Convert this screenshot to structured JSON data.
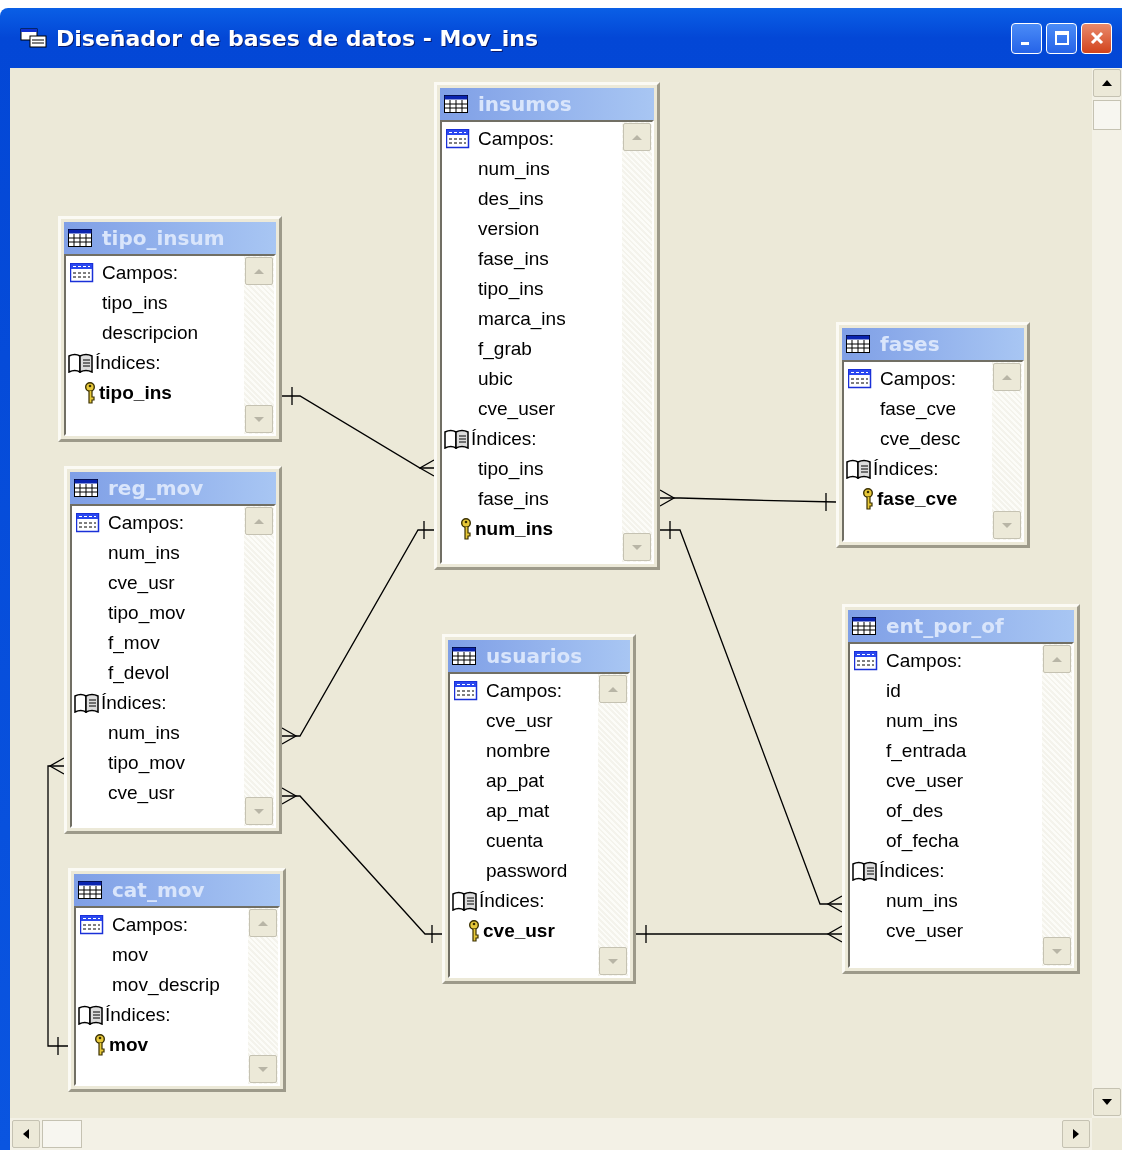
{
  "window": {
    "title": "Diseñador de bases de datos - Mov_ins"
  },
  "tables": [
    {
      "name": "tipo_insum",
      "items": [
        {
          "kind": "fields",
          "text": "Campos:"
        },
        {
          "kind": "field",
          "text": "tipo_ins"
        },
        {
          "kind": "field",
          "text": "descripcion"
        },
        {
          "kind": "indexes",
          "text": "Índices:"
        },
        {
          "kind": "key",
          "text": "tipo_ins"
        }
      ]
    },
    {
      "name": "reg_mov",
      "items": [
        {
          "kind": "fields",
          "text": "Campos:"
        },
        {
          "kind": "field",
          "text": "num_ins"
        },
        {
          "kind": "field",
          "text": "cve_usr"
        },
        {
          "kind": "field",
          "text": "tipo_mov"
        },
        {
          "kind": "field",
          "text": "f_mov"
        },
        {
          "kind": "field",
          "text": "f_devol"
        },
        {
          "kind": "indexes",
          "text": "Índices:"
        },
        {
          "kind": "field",
          "text": "num_ins"
        },
        {
          "kind": "field",
          "text": "tipo_mov"
        },
        {
          "kind": "field",
          "text": "cve_usr"
        }
      ]
    },
    {
      "name": "cat_mov",
      "items": [
        {
          "kind": "fields",
          "text": "Campos:"
        },
        {
          "kind": "field",
          "text": "mov"
        },
        {
          "kind": "field",
          "text": "mov_descrip"
        },
        {
          "kind": "indexes",
          "text": "Índices:"
        },
        {
          "kind": "key",
          "text": "mov"
        }
      ]
    },
    {
      "name": "insumos",
      "items": [
        {
          "kind": "fields",
          "text": "Campos:"
        },
        {
          "kind": "field",
          "text": "num_ins"
        },
        {
          "kind": "field",
          "text": "des_ins"
        },
        {
          "kind": "field",
          "text": "version"
        },
        {
          "kind": "field",
          "text": "fase_ins"
        },
        {
          "kind": "field",
          "text": "tipo_ins"
        },
        {
          "kind": "field",
          "text": "marca_ins"
        },
        {
          "kind": "field",
          "text": "f_grab"
        },
        {
          "kind": "field",
          "text": "ubic"
        },
        {
          "kind": "field",
          "text": "cve_user"
        },
        {
          "kind": "indexes",
          "text": "Índices:"
        },
        {
          "kind": "field",
          "text": "tipo_ins"
        },
        {
          "kind": "field",
          "text": "fase_ins"
        },
        {
          "kind": "key",
          "text": "num_ins"
        }
      ]
    },
    {
      "name": "usuarios",
      "items": [
        {
          "kind": "fields",
          "text": "Campos:"
        },
        {
          "kind": "field",
          "text": "cve_usr"
        },
        {
          "kind": "field",
          "text": "nombre"
        },
        {
          "kind": "field",
          "text": "ap_pat"
        },
        {
          "kind": "field",
          "text": "ap_mat"
        },
        {
          "kind": "field",
          "text": "cuenta"
        },
        {
          "kind": "field",
          "text": "password"
        },
        {
          "kind": "indexes",
          "text": "Índices:"
        },
        {
          "kind": "key",
          "text": "cve_usr"
        }
      ]
    },
    {
      "name": "fases",
      "items": [
        {
          "kind": "fields",
          "text": "Campos:"
        },
        {
          "kind": "field",
          "text": "fase_cve"
        },
        {
          "kind": "field",
          "text": "cve_desc"
        },
        {
          "kind": "indexes",
          "text": "Índices:"
        },
        {
          "kind": "key",
          "text": "fase_cve"
        }
      ]
    },
    {
      "name": "ent_por_of",
      "items": [
        {
          "kind": "fields",
          "text": "Campos:"
        },
        {
          "kind": "field",
          "text": "id"
        },
        {
          "kind": "field",
          "text": "num_ins"
        },
        {
          "kind": "field",
          "text": "f_entrada"
        },
        {
          "kind": "field",
          "text": "cve_user"
        },
        {
          "kind": "field",
          "text": "of_des"
        },
        {
          "kind": "field",
          "text": "of_fecha"
        },
        {
          "kind": "indexes",
          "text": "Índices:"
        },
        {
          "kind": "field",
          "text": "num_ins"
        },
        {
          "kind": "field",
          "text": "cve_user"
        }
      ]
    }
  ]
}
